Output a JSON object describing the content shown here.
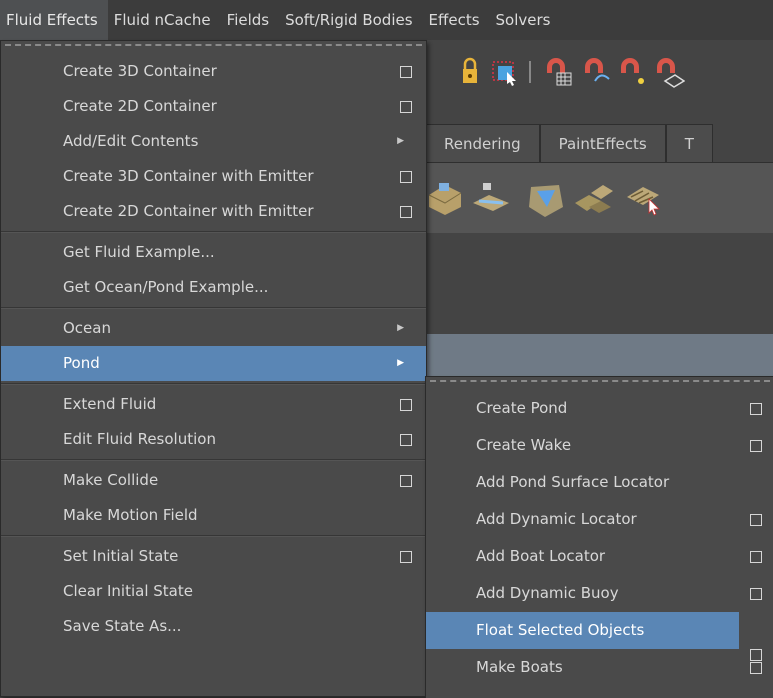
{
  "menubar": {
    "items": [
      "Fluid Effects",
      "Fluid nCache",
      "Fields",
      "Soft/Rigid Bodies",
      "Effects",
      "Solvers"
    ]
  },
  "shelf_tabs": [
    "Rendering",
    "PaintEffects",
    "T"
  ],
  "main_menu": {
    "groups": [
      [
        {
          "label": "Create 3D Container",
          "option_box": true
        },
        {
          "label": "Create 2D Container",
          "option_box": true
        },
        {
          "label": "Add/Edit Contents",
          "submenu": true
        },
        {
          "label": "Create 3D Container with Emitter",
          "option_box": true
        },
        {
          "label": "Create 2D Container with Emitter",
          "option_box": true
        }
      ],
      [
        {
          "label": "Get Fluid Example..."
        },
        {
          "label": "Get Ocean/Pond Example..."
        }
      ],
      [
        {
          "label": "Ocean",
          "submenu": true
        },
        {
          "label": "Pond",
          "submenu": true,
          "highlighted": true
        }
      ],
      [
        {
          "label": "Extend Fluid",
          "option_box": true
        },
        {
          "label": "Edit Fluid Resolution",
          "option_box": true
        }
      ],
      [
        {
          "label": "Make Collide",
          "option_box": true
        },
        {
          "label": "Make Motion Field"
        }
      ],
      [
        {
          "label": "Set Initial State",
          "option_box": true
        },
        {
          "label": "Clear Initial State"
        },
        {
          "label": "Save State As..."
        }
      ]
    ]
  },
  "sub_menu": {
    "items": [
      {
        "label": "Create Pond",
        "option_box": true
      },
      {
        "label": "Create Wake",
        "option_box": true
      },
      {
        "label": "Add Pond Surface Locator"
      },
      {
        "label": "Add Dynamic Locator",
        "option_box": true
      },
      {
        "label": "Add Boat Locator",
        "option_box": true
      },
      {
        "label": "Add Dynamic Buoy",
        "option_box": true
      },
      {
        "label": "Float Selected Objects",
        "option_box": true,
        "highlighted": true
      },
      {
        "label": "Make Boats",
        "option_box": true
      }
    ]
  },
  "icons": {
    "toolbar": [
      "lock-icon",
      "select-by-component-icon",
      "magnet-grid-icon",
      "magnet-curve-icon",
      "magnet-point-icon",
      "magnet-surface-icon"
    ],
    "shelf": [
      "create-3d-container-icon",
      "create-2d-container-icon",
      "ocean-icon",
      "pond-icon",
      "float-objects-icon"
    ]
  },
  "colors": {
    "highlight": "#5a86b5",
    "menu_bg": "#4a4a4a",
    "menubar_bg": "#3c3c3c"
  }
}
